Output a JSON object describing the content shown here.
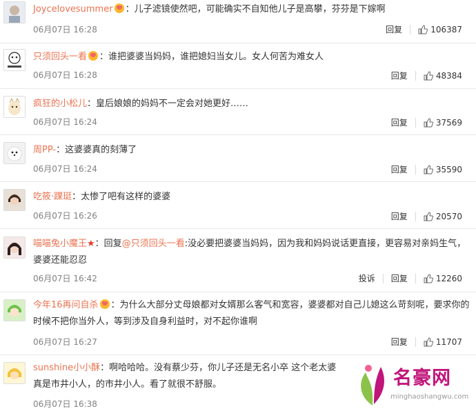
{
  "comments": [
    {
      "avatar_label": "",
      "user": "Joycelovesummer",
      "prefix": "",
      "reply_to": "",
      "body": "：儿子滤镜使然吧，可能确实不自知他儿子是高攀，芬芬是下嫁啊",
      "time": "06月07日 16:28",
      "reply_label": "回复",
      "likes": "106387",
      "report_label": ""
    },
    {
      "avatar_label": "",
      "user": "只须回头一看",
      "prefix": "",
      "reply_to": "",
      "body": "：谁把婆婆当妈妈，谁把媳妇当女儿。女人何苦为难女人",
      "time": "06月07日 16:28",
      "reply_label": "回复",
      "likes": "48384",
      "report_label": ""
    },
    {
      "avatar_label": "",
      "user": "疯狂的小松儿",
      "prefix": "",
      "reply_to": "",
      "body": "：皇后娘娘的妈妈不一定会对她更好……",
      "time": "06月07日 16:24",
      "reply_label": "回复",
      "likes": "37569",
      "report_label": ""
    },
    {
      "avatar_label": "",
      "user": "周PP-",
      "prefix": "",
      "reply_to": "",
      "body": "：这婆婆真的刻薄了",
      "time": "06月07日 16:24",
      "reply_label": "回复",
      "likes": "35590",
      "report_label": ""
    },
    {
      "avatar_label": "",
      "user": "吃筱·踝珽",
      "prefix": "",
      "reply_to": "",
      "body": "：太惨了吧有这样的婆婆",
      "time": "06月07日 16:26",
      "reply_label": "回复",
      "likes": "20570",
      "report_label": ""
    },
    {
      "avatar_label": "",
      "user": "喵喵兔小魔王",
      "prefix": "：回复",
      "reply_to": "@只须回头一看",
      "body": ":没必要把婆婆当妈妈，因为我和妈妈说话更直接，更容易对亲妈生气，婆婆还能忍忍",
      "time": "06月07日 16:42",
      "reply_label": "回复",
      "likes": "12260",
      "report_label": "投诉"
    },
    {
      "avatar_label": "",
      "user": "今年16再问自杀",
      "prefix": "",
      "reply_to": "",
      "body": "：为什么大部分丈母娘都对女婿那么客气和宽容，婆婆都对自己儿媳这么苛刻呢，要求你的时候不把你当外人，等到涉及自身利益时，对不起你谁啊",
      "time": "06月07日 16:27",
      "reply_label": "回复",
      "likes": "11707",
      "report_label": ""
    },
    {
      "avatar_label": "",
      "user": "sunshine小小酥",
      "prefix": "",
      "reply_to": "",
      "body": "：啊哈哈哈。没有蔡少芬，你儿子还是无名小卒 这个老太婆真是市井小人，的市井小人。看了就很不舒服。",
      "time": "06月07日 16:38",
      "reply_label": "",
      "likes": "",
      "report_label": ""
    }
  ],
  "watermark": {
    "title": "名豪网",
    "url": "minghaoshangwu.com"
  },
  "colors": {
    "username": "#eb7350",
    "time": "#808080",
    "brand": "#c0157a"
  }
}
